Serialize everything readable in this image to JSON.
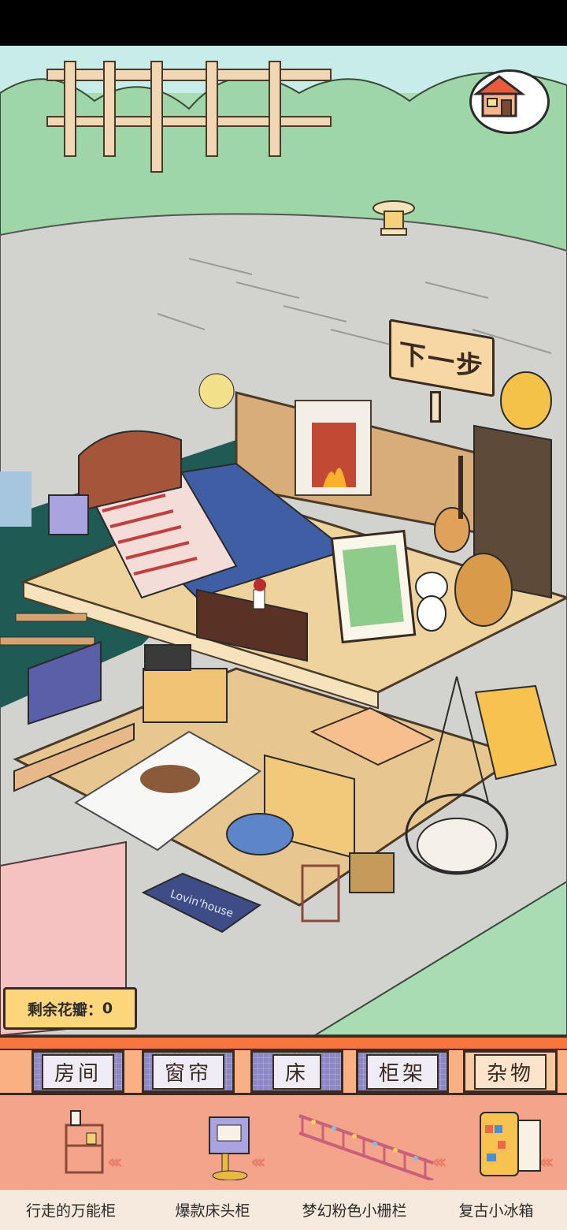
{
  "game": {
    "next_sign": "下一步",
    "petals_label": "剩余花瓣：",
    "petals_count": "0",
    "doormat_text": "Lovin'house"
  },
  "tabs": [
    {
      "label": "房间",
      "active": false
    },
    {
      "label": "窗帘",
      "active": false
    },
    {
      "label": "床",
      "active": false
    },
    {
      "label": "柜架",
      "active": false
    },
    {
      "label": "杂物",
      "active": true
    }
  ],
  "items": [
    {
      "name": "行走的万能柜",
      "icon": "walking-shelf-icon"
    },
    {
      "name": "爆款床头柜",
      "icon": "nightstand-icon"
    },
    {
      "name": "梦幻粉色小栅栏",
      "icon": "pink-fence-icon"
    },
    {
      "name": "复古小冰箱",
      "icon": "retro-fridge-icon"
    }
  ],
  "colors": {
    "grass": "#a9dcb2",
    "pavement": "#cfcfcb",
    "floor": "#e8c68f",
    "accent_orange": "#f7763f",
    "tab_purple": "#8c88c6",
    "shelf_pink": "#f4a48a"
  }
}
